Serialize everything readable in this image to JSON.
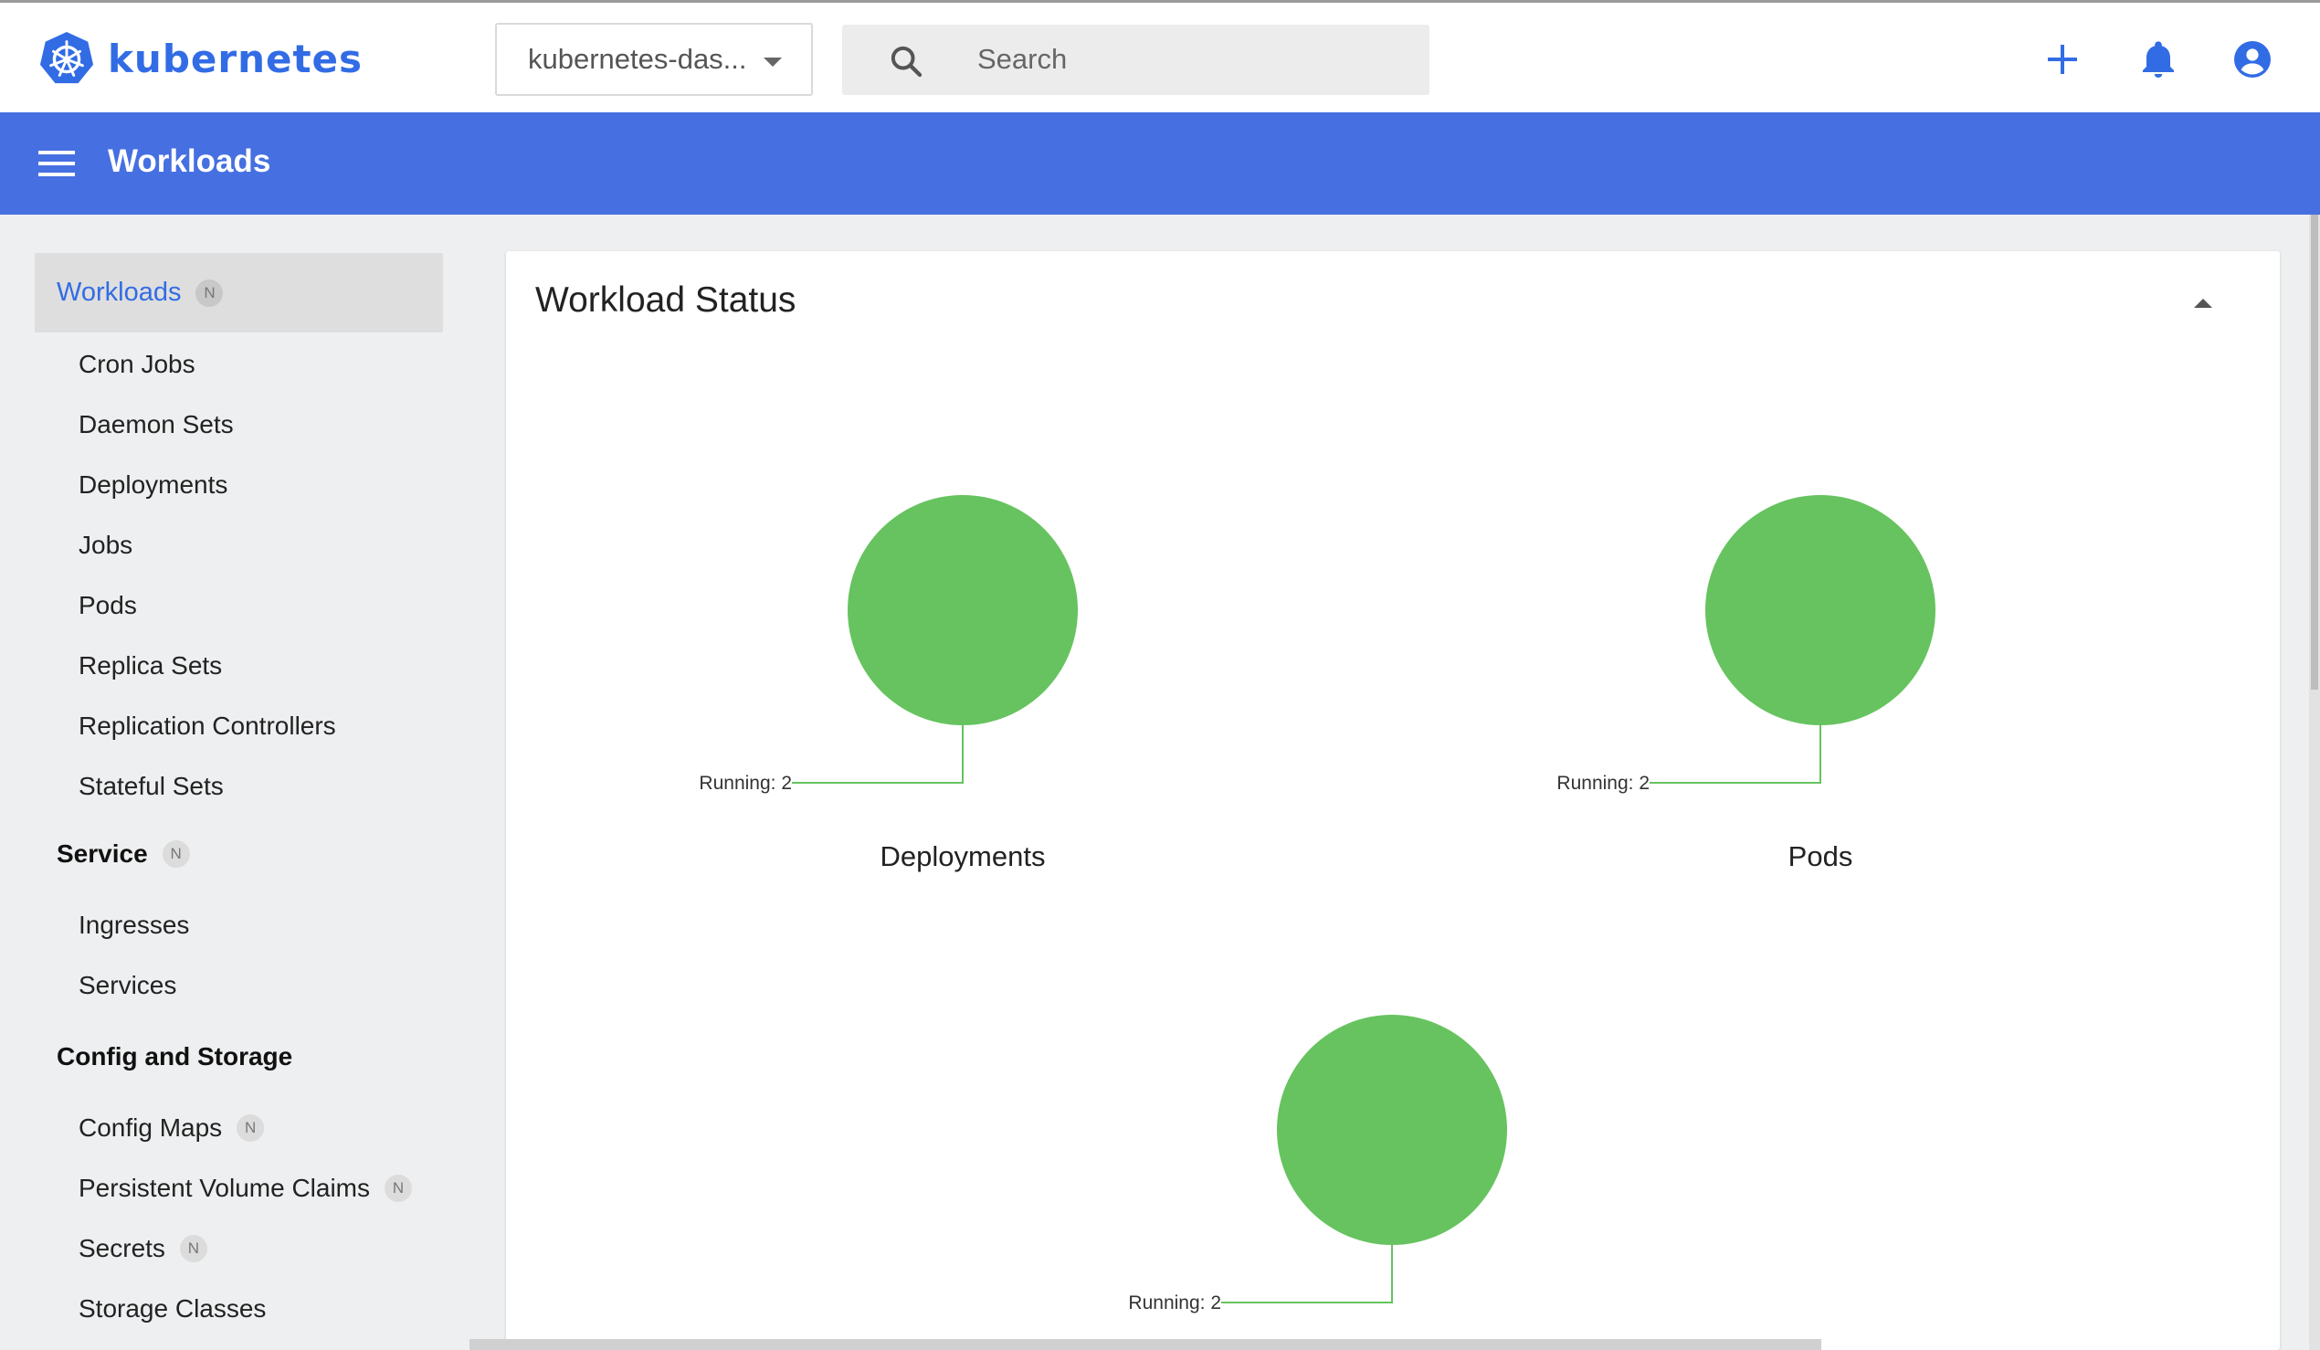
{
  "header": {
    "logo_text": "kubernetes",
    "namespace": "kubernetes-das...",
    "search_placeholder": "Search",
    "icons": [
      "plus-icon",
      "bell-icon",
      "account-circle-icon"
    ],
    "accent_color": "#326ce5"
  },
  "titlebar": {
    "title": "Workloads",
    "color": "#4670e1"
  },
  "sidebar": {
    "active": {
      "label": "Workloads",
      "badge": "N"
    },
    "workload_items": [
      "Cron Jobs",
      "Daemon Sets",
      "Deployments",
      "Jobs",
      "Pods",
      "Replica Sets",
      "Replication Controllers",
      "Stateful Sets"
    ],
    "service_header": {
      "label": "Service",
      "badge": "N"
    },
    "service_items": [
      "Ingresses",
      "Services"
    ],
    "config_header": {
      "label": "Config and Storage"
    },
    "config_items": [
      {
        "label": "Config Maps",
        "badge": "N"
      },
      {
        "label": "Persistent Volume Claims",
        "badge": "N"
      },
      {
        "label": "Secrets",
        "badge": "N"
      },
      {
        "label": "Storage Classes"
      }
    ]
  },
  "card": {
    "title": "Workload Status"
  },
  "chart_data": [
    {
      "type": "pie",
      "title": "Deployments",
      "slices": [
        {
          "label": "Running",
          "value": 2,
          "color": "#66c35f"
        }
      ]
    },
    {
      "type": "pie",
      "title": "Pods",
      "slices": [
        {
          "label": "Running",
          "value": 2,
          "color": "#66c35f"
        }
      ]
    },
    {
      "type": "pie",
      "title": "",
      "slices": [
        {
          "label": "Running",
          "value": 2,
          "color": "#66c35f"
        }
      ]
    }
  ]
}
